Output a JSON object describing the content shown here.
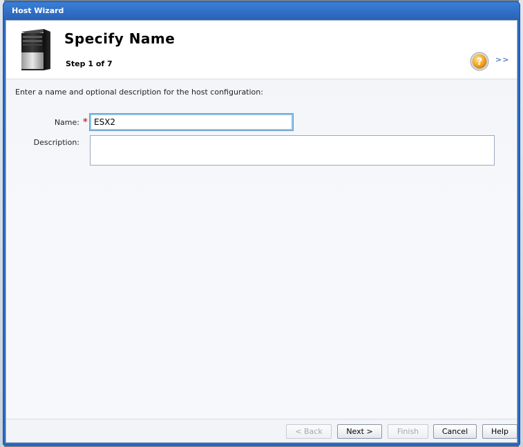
{
  "window": {
    "title": "Host Wizard"
  },
  "header": {
    "title": "Specify Name",
    "step": "Step 1 of 7",
    "expand_link": ">>",
    "icon": "server-tower-icon",
    "help_icon": "help-icon"
  },
  "form": {
    "instruction": "Enter a name and optional description for the host configuration:",
    "name_label": "Name:",
    "required_marker": "*",
    "name_value": "ESX2",
    "description_label": "Description:",
    "description_value": ""
  },
  "footer": {
    "buttons": [
      {
        "label": "< Back",
        "enabled": false
      },
      {
        "label": "Next >",
        "enabled": true
      },
      {
        "label": "Finish",
        "enabled": false
      },
      {
        "label": "Cancel",
        "enabled": true
      },
      {
        "label": "Help",
        "enabled": true
      }
    ]
  },
  "colors": {
    "titlebar": "#2b6bc3",
    "required": "#d0342c",
    "link": "#2a5db0"
  }
}
